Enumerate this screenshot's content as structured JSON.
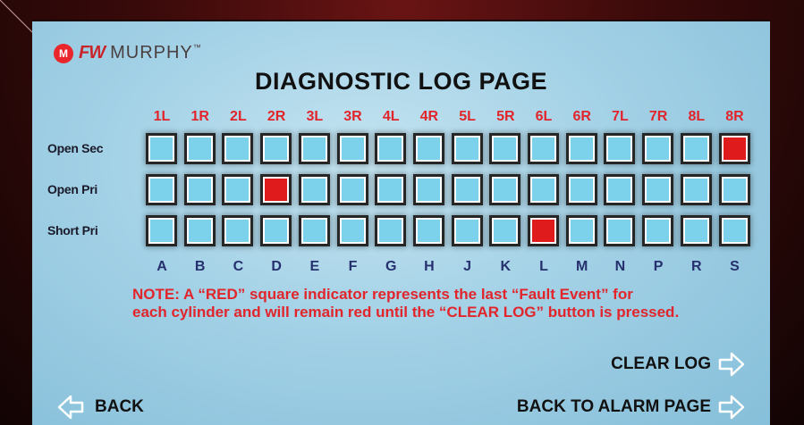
{
  "logo": {
    "badge": "M",
    "fw": "FW",
    "name": "MURPHY",
    "tm": "™"
  },
  "title": "DIAGNOSTIC LOG PAGE",
  "columns": [
    "1L",
    "1R",
    "2L",
    "2R",
    "3L",
    "3R",
    "4L",
    "4R",
    "5L",
    "5R",
    "6L",
    "6R",
    "7L",
    "7R",
    "8L",
    "8R"
  ],
  "cylinders": [
    "A",
    "B",
    "C",
    "D",
    "E",
    "F",
    "G",
    "H",
    "J",
    "K",
    "L",
    "M",
    "N",
    "P",
    "R",
    "S"
  ],
  "rows": [
    {
      "label": "Open Sec",
      "red_indices": [
        15
      ]
    },
    {
      "label": "Open Pri",
      "red_indices": [
        3
      ]
    },
    {
      "label": "Short Pri",
      "red_indices": [
        10
      ]
    }
  ],
  "colors": {
    "indicator_normal": "#7cd2ea",
    "indicator_fault": "#e01b1b",
    "accent_red": "#e1252b"
  },
  "note": {
    "line1": "NOTE: A “RED” square indicator represents the last “Fault Event”  for",
    "line2": "each cylinder and will remain red until the “CLEAR LOG” button is pressed."
  },
  "buttons": {
    "clear_log": "CLEAR LOG",
    "back": "BACK",
    "back_to_alarm": "BACK TO ALARM PAGE"
  }
}
